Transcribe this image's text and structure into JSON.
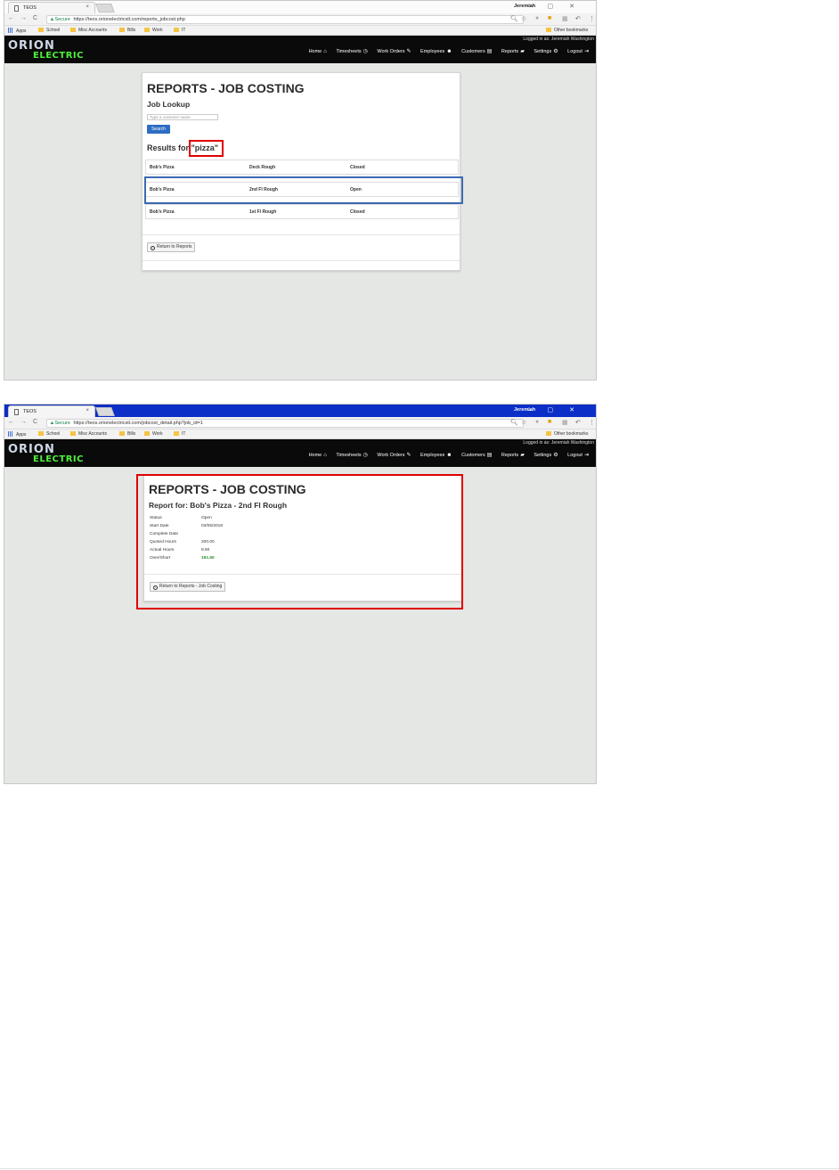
{
  "screenshots": [
    {
      "tab_title": "TEOS",
      "window_user": "Jeremiah",
      "secure_label": "Secure",
      "url": "https://teos.orionelectricstl.com/reports_jobcost.php",
      "bookmarks": [
        "Apps",
        "School",
        "Misc Accounts",
        "Bills",
        "Work",
        "IT"
      ],
      "other_bookmarks": "Other bookmarks",
      "logo_top": "ORION",
      "logo_bottom": "ELECTRIC",
      "logged_in": "Logged in as: Jeremiah Washington",
      "menu": [
        "Home",
        "Timesheets",
        "Work Orders",
        "Employees",
        "Customers",
        "Reports",
        "Settings",
        "Logout"
      ],
      "page_title": "REPORTS - JOB COSTING",
      "section_title": "Job Lookup",
      "search_placeholder": "Type a customer name",
      "search_button": "Search",
      "results_prefix": "Results for",
      "results_query": "\"pizza\"",
      "rows": [
        {
          "customer": "Bob's Pizza",
          "job": "Deck Rough",
          "status": "Closed"
        },
        {
          "customer": "Bob's Pizza",
          "job": "2nd Fl Rough",
          "status": "Open"
        },
        {
          "customer": "Bob's Pizza",
          "job": "1st Fl Rough",
          "status": "Closed"
        }
      ],
      "return_button": "Return to Reports"
    },
    {
      "tab_title": "TEOS",
      "window_user": "Jeremiah",
      "secure_label": "Secure",
      "url": "https://teos.orionelectricstl.com/jobcost_detail.php?job_id=1",
      "bookmarks": [
        "Apps",
        "School",
        "Misc Accounts",
        "Bills",
        "Work",
        "IT"
      ],
      "other_bookmarks": "Other bookmarks",
      "logo_top": "ORION",
      "logo_bottom": "ELECTRIC",
      "logged_in": "Logged in as: Jeremiah Washington",
      "menu": [
        "Home",
        "Timesheets",
        "Work Orders",
        "Employees",
        "Customers",
        "Reports",
        "Settings",
        "Logout"
      ],
      "page_title": "REPORTS - JOB COSTING",
      "report_for": "Report for: Bob's Pizza - 2nd Fl Rough",
      "details": [
        {
          "label": "Status",
          "value": "Open"
        },
        {
          "label": "Start Date",
          "value": "03/05/2018"
        },
        {
          "label": "Complete Date",
          "value": ""
        },
        {
          "label": "Quoted Hours",
          "value": "200.00"
        },
        {
          "label": "Actual Hours",
          "value": "8.50"
        },
        {
          "label": "Over/Short",
          "value": "191.50"
        }
      ],
      "return_button": "Return to Reports - Job Costing"
    }
  ],
  "colors": {
    "highlight_red": "#e00000",
    "highlight_blue": "#3c6ab0",
    "logo_green": "#4ef03a",
    "primary_button": "#2d6dc4",
    "page_background": "#e5e7e5"
  }
}
